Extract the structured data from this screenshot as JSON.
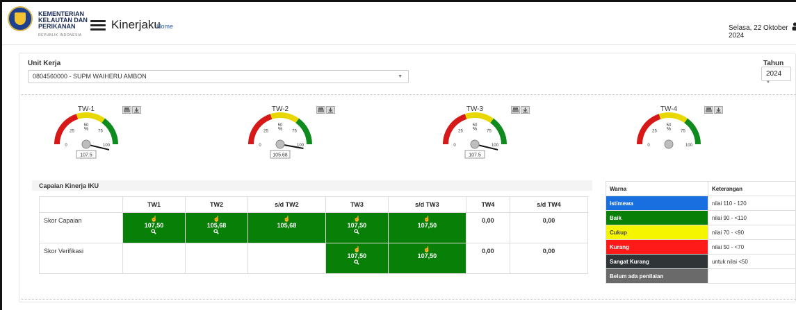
{
  "header": {
    "org_lines": [
      "KEMENTERIAN",
      "KELAUTAN DAN",
      "PERIKANAN"
    ],
    "org_sub": "REPUBLIK INDONESIA",
    "app_title": "Kinerjaku",
    "home_link": "Home",
    "date": "Selasa, 22 Oktober 2024"
  },
  "filters": {
    "unit_label": "Unit Kerja",
    "unit_value": "0804560000 - SUPM WAIHERU AMBON",
    "tahun_label": "Tahun",
    "tahun_value": "2024"
  },
  "gauges": [
    {
      "title": "TW-1",
      "unit": "%",
      "value": 107.5,
      "value_label": "107.5",
      "ticks": [
        "0",
        "25",
        "50",
        "75",
        "100"
      ]
    },
    {
      "title": "TW-2",
      "unit": "%",
      "value": 105.68,
      "value_label": "105.68",
      "ticks": [
        "0",
        "25",
        "50",
        "75",
        "100"
      ]
    },
    {
      "title": "TW-3",
      "unit": "%",
      "value": 107.5,
      "value_label": "107.5",
      "ticks": [
        "0",
        "25",
        "50",
        "75",
        "100"
      ]
    },
    {
      "title": "TW-4",
      "unit": "%",
      "value": null,
      "value_label": "",
      "ticks": [
        "0",
        "25",
        "50",
        "75",
        "100"
      ]
    }
  ],
  "gauge_colors": {
    "red": "#d71818",
    "yellow": "#e8d800",
    "green": "#0f8a1e"
  },
  "section_title": "Capaian Kinerja IKU",
  "score_table": {
    "columns": [
      "",
      "TW1",
      "TW2",
      "s/d TW2",
      "TW3",
      "s/d TW3",
      "TW4",
      "s/d TW4"
    ],
    "rows": [
      {
        "label": "Skor Capaian",
        "cells": [
          {
            "value": "107,50",
            "color": "green",
            "search": true
          },
          {
            "value": "105,68",
            "color": "green",
            "search": true
          },
          {
            "value": "105,68",
            "color": "green",
            "search": false
          },
          {
            "value": "107,50",
            "color": "green",
            "search": true
          },
          {
            "value": "107,50",
            "color": "green",
            "search": false
          },
          {
            "value": "0,00",
            "color": "none",
            "search": false
          },
          {
            "value": "0,00",
            "color": "none",
            "search": false
          }
        ]
      },
      {
        "label": "Skor Verifikasi",
        "cells": [
          {
            "value": "",
            "color": "none",
            "search": false
          },
          {
            "value": "",
            "color": "none",
            "search": false
          },
          {
            "value": "",
            "color": "none",
            "search": false
          },
          {
            "value": "107,50",
            "color": "green",
            "search": true
          },
          {
            "value": "107,50",
            "color": "green",
            "search": false
          },
          {
            "value": "0,00",
            "color": "none",
            "search": false
          },
          {
            "value": "0,00",
            "color": "none",
            "search": false
          }
        ]
      }
    ]
  },
  "legend": {
    "header_color": "Warna",
    "header_desc": "Keterangan",
    "rows": [
      {
        "label": "Istimewa",
        "desc": "nilai 110 - 120",
        "color": "#1a6fe0",
        "text_color": "#ffffff"
      },
      {
        "label": "Baik",
        "desc": "nilai 90 - <110",
        "color": "#088008",
        "text_color": "#ffffff"
      },
      {
        "label": "Cukup",
        "desc": "nilai 70 - <90",
        "color": "#f5f500",
        "text_color": "#444444"
      },
      {
        "label": "Kurang",
        "desc": "nilai 50 - <70",
        "color": "#ff1a1a",
        "text_color": "#ffffff"
      },
      {
        "label": "Sangat Kurang",
        "desc": "untuk nilai <50",
        "color": "#2f3437",
        "text_color": "#ffffff"
      },
      {
        "label": "Belum ada penilaian",
        "desc": "",
        "color": "#6a6a6a",
        "text_color": "#ffffff"
      }
    ]
  }
}
